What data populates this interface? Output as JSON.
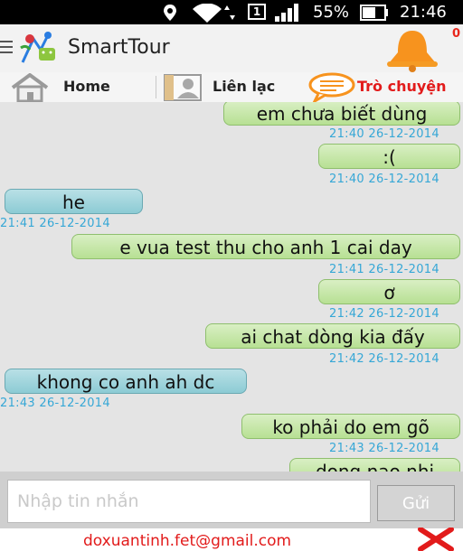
{
  "status_bar": {
    "battery": "55%",
    "time": "21:46",
    "sim": "1"
  },
  "app": {
    "title": "SmartTour",
    "notification_count": "0"
  },
  "tabs": [
    {
      "label": "Home",
      "active": false
    },
    {
      "label": "Liên lạc",
      "active": false
    },
    {
      "label": "Trò chuyện",
      "active": true
    }
  ],
  "messages": [
    {
      "text": "em chưa biết dùng",
      "time": "21:40 26-12-2014",
      "side": "right"
    },
    {
      "text": ":(",
      "time": "21:40 26-12-2014",
      "side": "right"
    },
    {
      "text": "he",
      "time": "21:41 26-12-2014",
      "side": "left"
    },
    {
      "text": "e vua test thu cho anh 1 cai day",
      "time": "21:41 26-12-2014",
      "side": "right"
    },
    {
      "text": "ơ",
      "time": "21:42 26-12-2014",
      "side": "right"
    },
    {
      "text": "ai chat dòng kia đấy",
      "time": "21:42 26-12-2014",
      "side": "right"
    },
    {
      "text": "khong co anh ah dc",
      "time": "21:43 26-12-2014",
      "side": "left"
    },
    {
      "text": "ko phải do em gõ",
      "time": "21:43 26-12-2014",
      "side": "right"
    },
    {
      "text": "dong nao nhi",
      "time": "",
      "side": "right"
    }
  ],
  "composer": {
    "placeholder": "Nhập tin nhắn",
    "value": "",
    "send_label": "Gửi"
  },
  "footer": {
    "email": "doxuantinh.fet@gmail.com"
  },
  "colors": {
    "sent_bubble": "#c8e8a8",
    "received_bubble": "#a8d8de",
    "timestamp": "#36a7d6",
    "accent_red": "#e21b1b",
    "bell": "#f7931e"
  }
}
